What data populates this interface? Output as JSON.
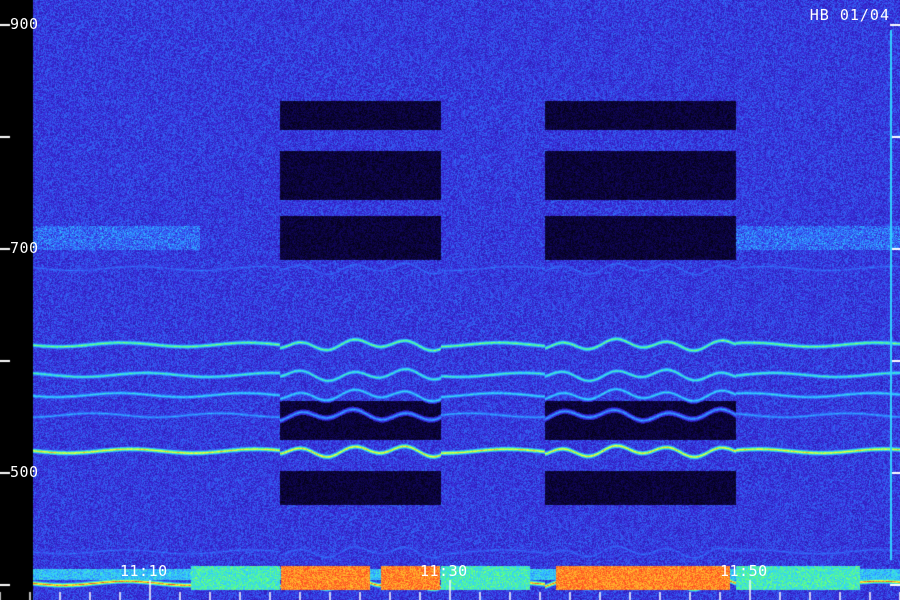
{
  "badge": "HB 01/04",
  "chart_data": {
    "type": "heatmap",
    "title": "",
    "xlabel": "",
    "ylabel": "",
    "x_ticks": [
      "11:10",
      "11:30",
      "11:50"
    ],
    "x_minor_ticks_per_major": 10,
    "x_range_minutes": [
      0,
      57
    ],
    "y_ticks": [
      900,
      800,
      700,
      600,
      500,
      400
    ],
    "y_tick_labels": [
      "900",
      "700",
      "500"
    ],
    "y_range": [
      400,
      900
    ],
    "grid": false,
    "colormap": [
      "#000000",
      "#1a0a8a",
      "#3a2ad8",
      "#2f7cff",
      "#33d0ff",
      "#55ff88",
      "#ffff33",
      "#ff4422"
    ],
    "bands": [
      {
        "center": 615,
        "intensity": 0.7
      },
      {
        "center": 588,
        "intensity": 0.62
      },
      {
        "center": 570,
        "intensity": 0.55
      },
      {
        "center": 552,
        "intensity": 0.45
      },
      {
        "center": 520,
        "intensity": 0.85
      },
      {
        "center": 683,
        "intensity": 0.35
      },
      {
        "center": 430,
        "intensity": 0.35
      },
      {
        "center": 402,
        "intensity": 0.95
      }
    ]
  }
}
